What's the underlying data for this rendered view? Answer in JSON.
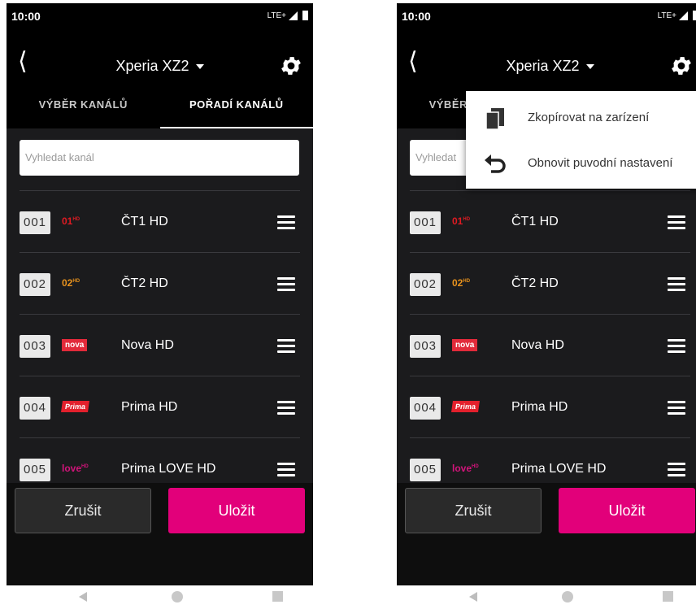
{
  "status_bar": {
    "time": "10:00",
    "network": "LTE+"
  },
  "header": {
    "device_name": "Xperia XZ2"
  },
  "tabs": [
    {
      "label": "VÝBĚR KANÁLŮ",
      "active": false
    },
    {
      "label": "POŘADÍ KANÁLŮ",
      "active": true
    }
  ],
  "search": {
    "placeholder": "Vyhledat kanál"
  },
  "search_right": {
    "placeholder": "Vyhledat"
  },
  "channels": [
    {
      "number": "001",
      "logo": "ČT1 HD",
      "logo_text": "01",
      "name": "ČT1 HD"
    },
    {
      "number": "002",
      "logo": "ČT2 HD",
      "logo_text": "02",
      "name": "ČT2 HD"
    },
    {
      "number": "003",
      "logo": "Nova HD",
      "logo_text": "nova",
      "name": "Nova HD"
    },
    {
      "number": "004",
      "logo": "Prima HD",
      "logo_text": "Prima",
      "name": "Prima HD"
    },
    {
      "number": "005",
      "logo": "Prima LOVE HD",
      "logo_text": "love",
      "name": "Prima LOVE HD"
    }
  ],
  "buttons": {
    "cancel": "Zrušit",
    "save": "Uložit"
  },
  "settings_menu": {
    "items": [
      {
        "label": "Zkopírovat na zarízení",
        "icon": "copy-icon"
      },
      {
        "label": "Obnovit puvodní nastavení",
        "icon": "undo-icon"
      }
    ]
  },
  "colors": {
    "accent": "#e2007a",
    "background": "#1b1b1d"
  }
}
